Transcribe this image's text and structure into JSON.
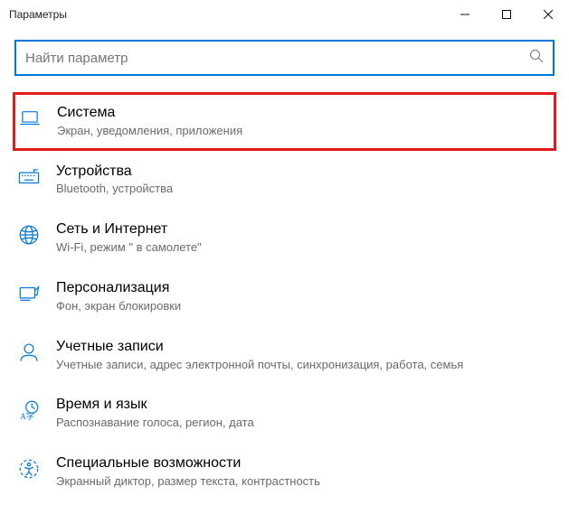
{
  "window": {
    "title": "Параметры"
  },
  "search": {
    "placeholder": "Найти параметр"
  },
  "categories": [
    {
      "id": "system",
      "title": "Система",
      "desc": "Экран, уведомления, приложения",
      "highlighted": true
    },
    {
      "id": "devices",
      "title": "Устройства",
      "desc": "Bluetooth, устройства"
    },
    {
      "id": "network",
      "title": "Сеть и Интернет",
      "desc": "Wi-Fi, режим \" в самолете\""
    },
    {
      "id": "personalization",
      "title": "Персонализация",
      "desc": "Фон, экран блокировки"
    },
    {
      "id": "accounts",
      "title": "Учетные записи",
      "desc": "Учетные записи, адрес электронной почты, синхронизация, работа, семья"
    },
    {
      "id": "timelanguage",
      "title": "Время и язык",
      "desc": "Распознавание голоса, регион, дата"
    },
    {
      "id": "easeofaccess",
      "title": "Специальные возможности",
      "desc": "Экранный диктор, размер текста, контрастность"
    }
  ],
  "icons": {
    "system": "laptop-icon",
    "devices": "keyboard-icon",
    "network": "globe-icon",
    "personalization": "paintbrush-icon",
    "accounts": "person-icon",
    "timelanguage": "time-language-icon",
    "easeofaccess": "ease-of-access-icon"
  }
}
